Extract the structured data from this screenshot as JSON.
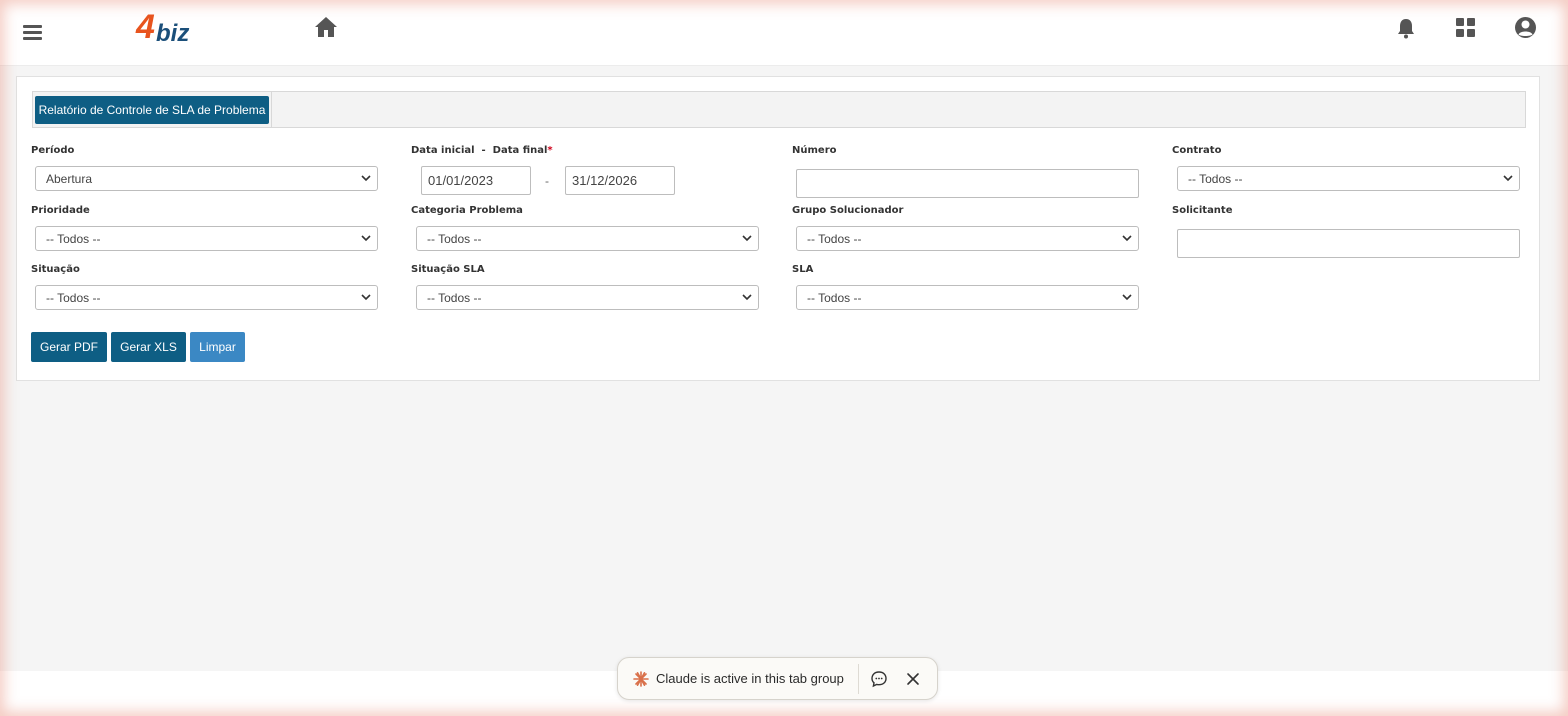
{
  "header": {
    "logo_number": "4",
    "logo_text": "biz",
    "icons": [
      "menu-icon",
      "home-icon",
      "bell-icon",
      "apps-grid-icon",
      "user-icon"
    ]
  },
  "tabs": [
    {
      "label": "Relatório de Controle de SLA de Problema",
      "active": true
    }
  ],
  "form": {
    "periodo": {
      "label": "Período",
      "value": "Abertura"
    },
    "datas": {
      "label": "Data inicial  -  Data final",
      "required_mark": "*",
      "start_value": "01/01/2023",
      "separator": "-",
      "end_value": "31/12/2026"
    },
    "numero": {
      "label": "Número",
      "value": ""
    },
    "contrato": {
      "label": "Contrato",
      "value": "-- Todos --"
    },
    "prioridade": {
      "label": "Prioridade",
      "value": "-- Todos --"
    },
    "categoria_problema": {
      "label": "Categoria Problema",
      "value": "-- Todos --"
    },
    "grupo_solucionador": {
      "label": "Grupo Solucionador",
      "value": "-- Todos --"
    },
    "solicitante": {
      "label": "Solicitante",
      "value": ""
    },
    "situacao": {
      "label": "Situação",
      "value": "-- Todos --"
    },
    "situacao_sla": {
      "label": "Situação SLA",
      "value": "-- Todos --"
    },
    "sla": {
      "label": "SLA",
      "value": "-- Todos --"
    }
  },
  "buttons": {
    "gerar_pdf": "Gerar PDF",
    "gerar_xls": "Gerar XLS",
    "limpar": "Limpar"
  },
  "toast": {
    "text": "Claude is active in this tab group"
  },
  "colors": {
    "primary": "#0e5e84",
    "secondary_button": "#3b88c4",
    "logo_orange": "#e8541e",
    "logo_blue": "#1b4f7a",
    "required": "#d0021b"
  }
}
